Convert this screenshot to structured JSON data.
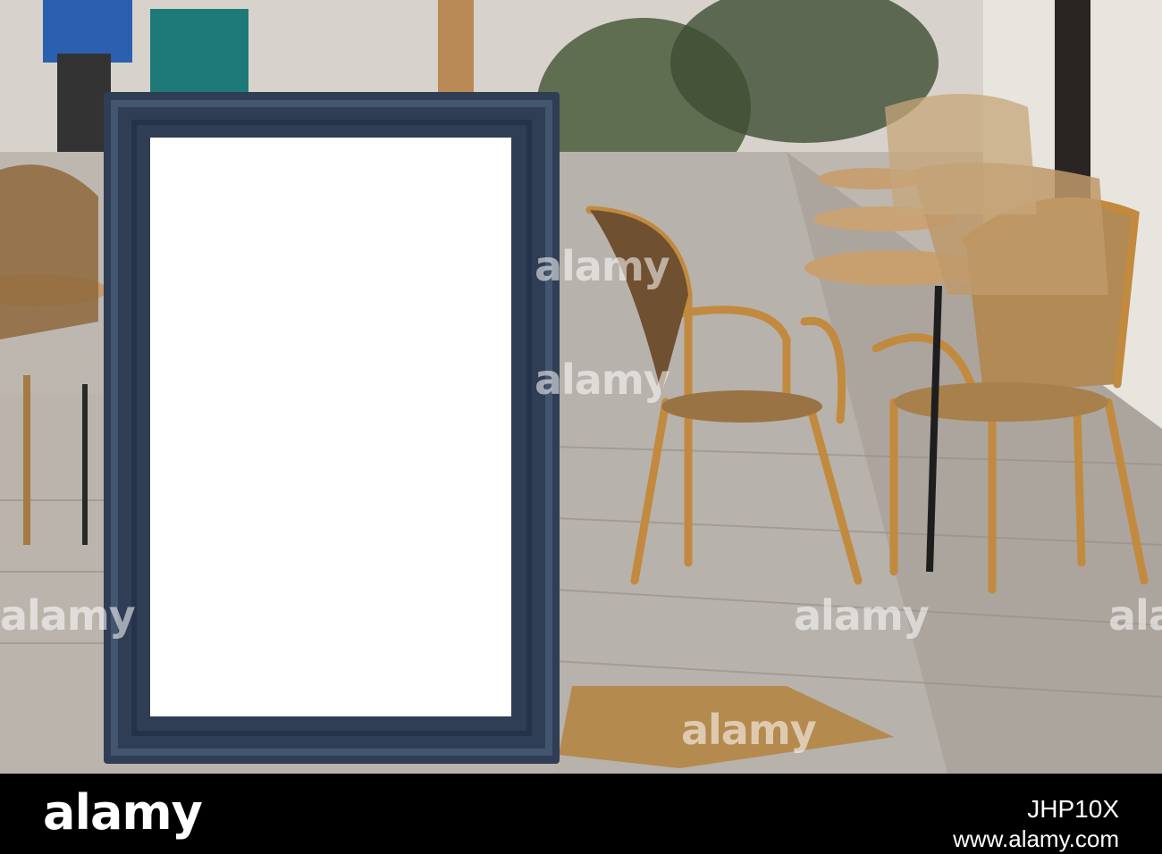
{
  "photo": {
    "description_icons": [
      "sandwich-board-sign",
      "wicker-chair",
      "bistro-table",
      "door-mat",
      "potted-plant"
    ],
    "colors": {
      "frame": "#2f3f55",
      "panel": "#ffffff",
      "wicker": "#b9863e",
      "pavement": "#b3ada6"
    }
  },
  "watermarks": {
    "text": "alamy"
  },
  "footer": {
    "brand": "alamy",
    "image_id": "JHP10X",
    "site": "www.alamy.com"
  }
}
